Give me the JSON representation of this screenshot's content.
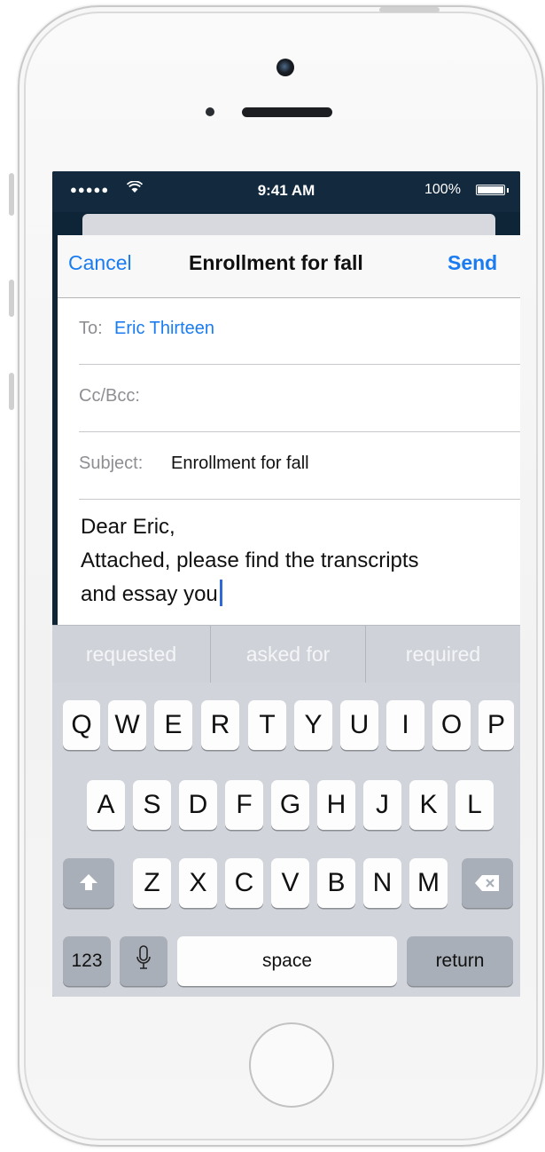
{
  "status_bar": {
    "signal": "●●●●●",
    "wifi_icon": "wifi-icon",
    "time": "9:41 AM",
    "battery": "100%"
  },
  "compose": {
    "cancel": "Cancel",
    "title": "Enrollment for fall",
    "send": "Send",
    "to_label": "To:",
    "to_value": "Eric Thirteen",
    "cc_label": "Cc/Bcc:",
    "subject_label": "Subject:",
    "subject_value": "Enrollment for fall",
    "body_line1": "Dear Eric,",
    "body_line2": "Attached, please find the transcripts",
    "body_line3": "and essay you"
  },
  "suggestions": [
    "requested",
    "asked for",
    "required"
  ],
  "keyboard": {
    "row1": [
      "Q",
      "W",
      "E",
      "R",
      "T",
      "Y",
      "U",
      "I",
      "O",
      "P"
    ],
    "row2": [
      "A",
      "S",
      "D",
      "F",
      "G",
      "H",
      "J",
      "K",
      "L"
    ],
    "row3": [
      "Z",
      "X",
      "C",
      "V",
      "B",
      "N",
      "M"
    ],
    "numbers": "123",
    "space": "space",
    "return": "return",
    "icons": {
      "shift": "shift-icon",
      "delete": "delete-icon",
      "mic": "microphone-icon"
    }
  }
}
